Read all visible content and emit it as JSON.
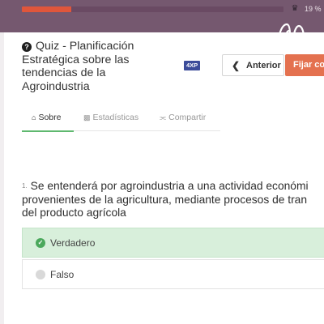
{
  "progress": {
    "percent": 19,
    "label": "19 %",
    "trophy_icon": "trophy-icon"
  },
  "header": {
    "help_icon": "question-circle-icon",
    "title": "Quiz - Planificación Estratégica sobre las tendencias de la Agroindustria",
    "xp_badge": "4XP"
  },
  "nav": {
    "prev_label": "Anterior",
    "prev_icon": "chevron-left-icon",
    "fix_label": "Fijar co"
  },
  "tabs": [
    {
      "label": "Sobre",
      "icon": "home-icon",
      "active": true
    },
    {
      "label": "Estadísticas",
      "icon": "bar-chart-icon",
      "active": false
    },
    {
      "label": "Compartir",
      "icon": "share-icon",
      "active": false
    }
  ],
  "question": {
    "number": "1.",
    "lines": [
      "Se entenderá por agroindustria a una actividad económi",
      "provenientes de la agricultura, mediante procesos de tran",
      "del producto agrícola"
    ]
  },
  "options": [
    {
      "label": "Verdadero",
      "selected": true
    },
    {
      "label": "Falso",
      "selected": false
    }
  ],
  "colors": {
    "frame": "#75586f",
    "progress": "#e0563b",
    "accent_green": "#5fb86f",
    "selected_bg": "#d8efdb",
    "fix_button": "#e4714f",
    "xp_badge": "#3c4c9a"
  }
}
